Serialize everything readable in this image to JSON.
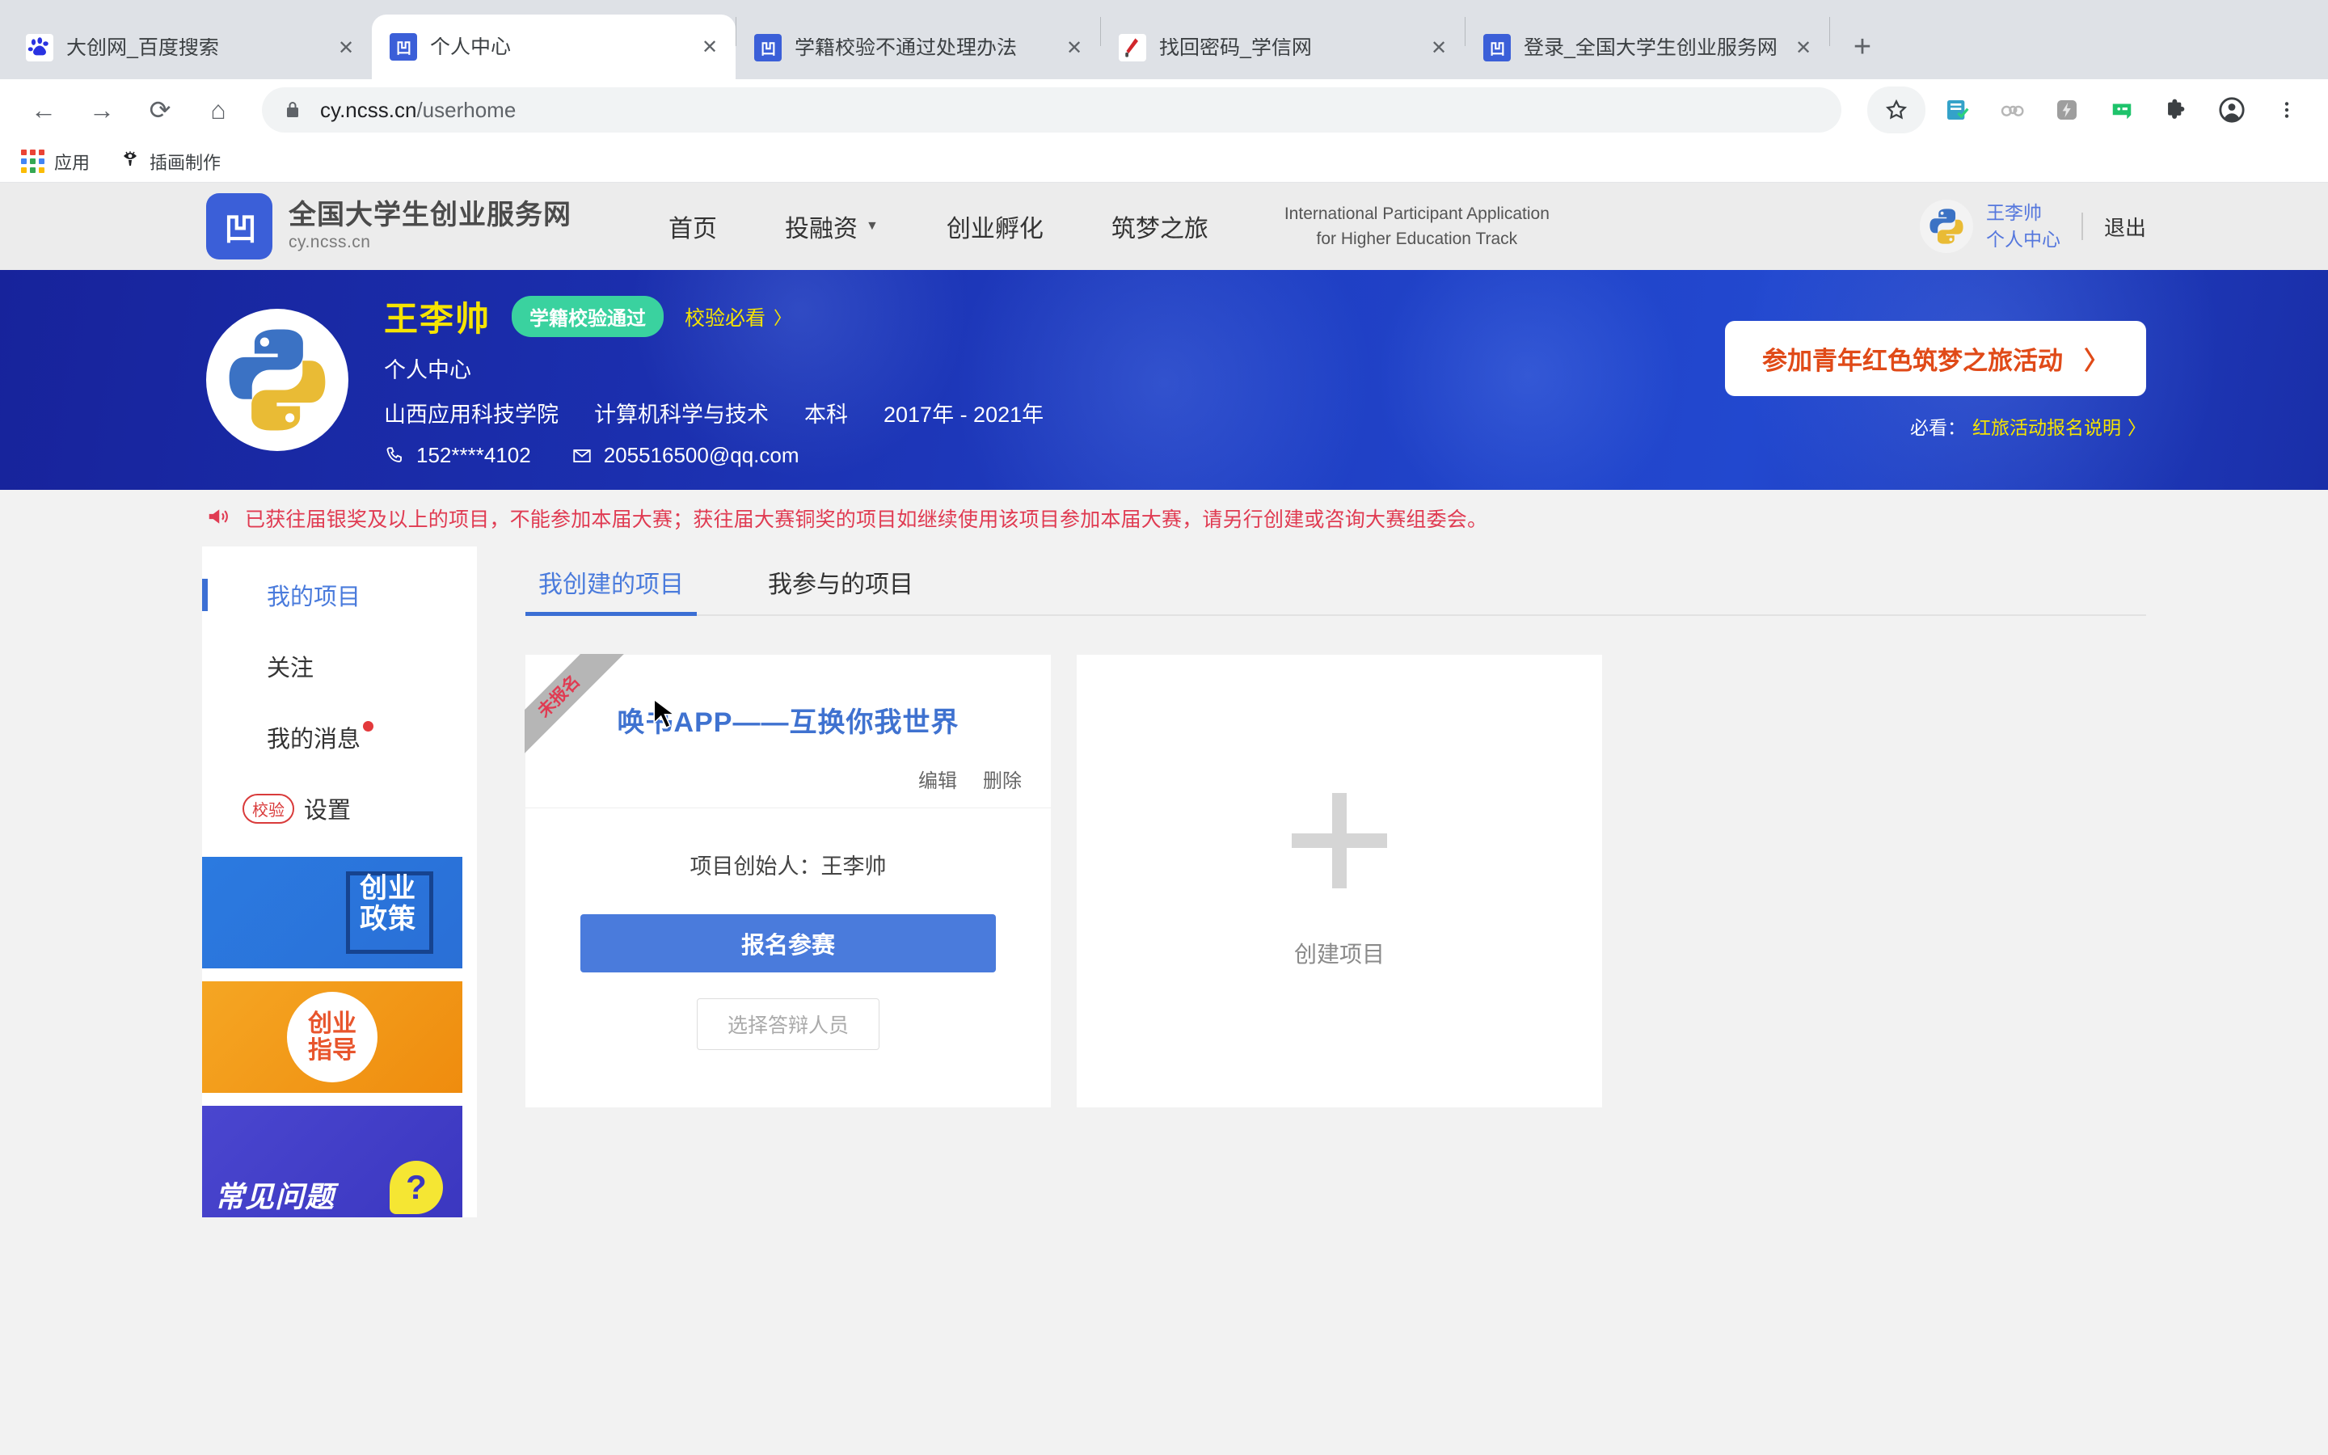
{
  "browser": {
    "tabs": [
      {
        "title": "大创网_百度搜索",
        "favicon": "baidu-icon",
        "active": false
      },
      {
        "title": "个人中心",
        "favicon": "ncss-icon",
        "active": true
      },
      {
        "title": "学籍校验不通过处理办法",
        "favicon": "ncss-icon",
        "active": false
      },
      {
        "title": "找回密码_学信网",
        "favicon": "chsi-icon",
        "active": false
      },
      {
        "title": "登录_全国大学生创业服务网",
        "favicon": "ncss-icon",
        "active": false
      }
    ],
    "new_tab_label": "+",
    "close_label": "✕",
    "nav": {
      "back": "←",
      "forward": "→",
      "reload": "⟳",
      "home": "⌂"
    },
    "omnibox": {
      "host": "cy.ncss.cn",
      "path": "/userhome",
      "lock_icon": "lock-icon"
    },
    "toolbar_icons": [
      "bookmark-star-icon",
      "notes-extension-icon",
      "rings-extension-icon",
      "flash-extension-icon",
      "messages-extension-icon",
      "puzzle-extensions-icon",
      "profile-avatar-icon",
      "chrome-menu-icon"
    ],
    "bookmarks": [
      {
        "label": "应用",
        "icon": "apps-grid-icon"
      },
      {
        "label": "插画制作",
        "icon": "illustration-icon"
      }
    ]
  },
  "site_header": {
    "brand_name": "全国大学生创业服务网",
    "brand_sub": "cy.ncss.cn",
    "brand_logo_text": "凹",
    "nav": [
      {
        "label": "首页",
        "has_caret": false
      },
      {
        "label": "投融资",
        "has_caret": true
      },
      {
        "label": "创业孵化",
        "has_caret": false
      },
      {
        "label": "筑梦之旅",
        "has_caret": false
      }
    ],
    "intl_line1": "International Participant Application",
    "intl_line2": "for Higher Education Track",
    "user_name": "王李帅",
    "user_center": "个人中心",
    "logout": "退出",
    "avatar_icon": "python-logo-avatar"
  },
  "profile": {
    "avatar_icon": "python-logo-avatar",
    "name": "王李帅",
    "badge": "学籍校验通过",
    "must_see": "校验必看",
    "must_see_chevron": "〉",
    "subtitle": "个人中心",
    "school": "山西应用科技学院",
    "major": "计算机科学与技术",
    "degree": "本科",
    "years": "2017年 - 2021年",
    "phone_icon": "phone-icon",
    "phone": "152****4102",
    "email_icon": "mail-icon",
    "email": "205516500@qq.com",
    "cta_label": "参加青年红色筑梦之旅活动",
    "cta_chevron": "〉",
    "cta_sub_label": "必看：",
    "cta_sub_link": "红旅活动报名说明",
    "cta_sub_chevron": "〉",
    "banner_bg": "#1f3fc4",
    "badge_color": "#3ad29f",
    "name_color": "#f6e400"
  },
  "notice": {
    "icon": "megaphone-icon",
    "text": "已获往届银奖及以上的项目，不能参加本届大赛；获往届大赛铜奖的项目如继续使用该项目参加本届大赛，请另行创建或咨询大赛组委会。",
    "color": "#e03b52"
  },
  "sidebar": {
    "items": [
      {
        "label": "我的项目",
        "active": true,
        "badge": false,
        "chip": null
      },
      {
        "label": "关注",
        "active": false,
        "badge": false,
        "chip": null
      },
      {
        "label": "我的消息",
        "active": false,
        "badge": true,
        "chip": null
      },
      {
        "label": "设置",
        "active": false,
        "badge": false,
        "chip": "校验"
      }
    ],
    "banners": [
      {
        "id": "policy",
        "line1": "创业",
        "line2": "政策",
        "style": "blue"
      },
      {
        "id": "guidance",
        "line1": "创业",
        "line2": "指导",
        "style": "orange"
      },
      {
        "id": "faq",
        "line1": "常见问题",
        "line2": "",
        "style": "purple",
        "mark": "?"
      }
    ]
  },
  "main": {
    "tabs": [
      {
        "label": "我创建的项目",
        "active": true
      },
      {
        "label": "我参与的项目",
        "active": false
      }
    ],
    "project_card": {
      "ribbon": "未报名",
      "title": "唤书APP——互换你我世界",
      "edit_label": "编辑",
      "delete_label": "删除",
      "founder_label": "项目创始人：",
      "founder_name": "王李帅",
      "primary_button": "报名参赛",
      "secondary_button": "选择答辩人员",
      "title_color": "#3f72d0",
      "primary_color": "#4a7bdc"
    },
    "create_card": {
      "plus_icon": "plus-icon",
      "label": "创建项目"
    }
  }
}
